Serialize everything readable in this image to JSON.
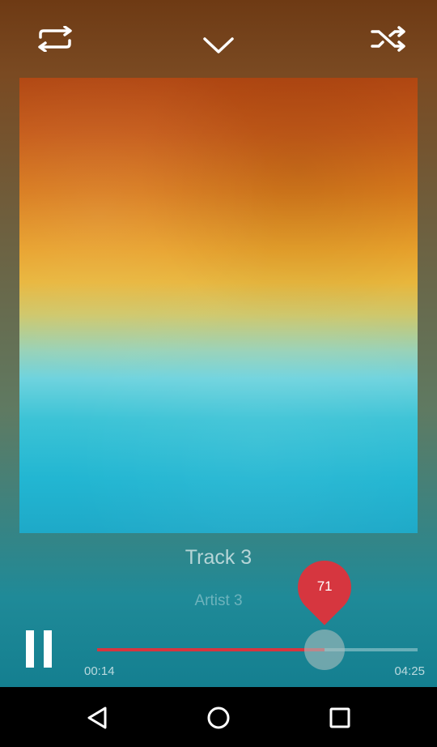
{
  "top": {
    "repeat_icon": "repeat-icon",
    "collapse_icon": "chevron-down-icon",
    "shuffle_icon": "shuffle-icon"
  },
  "track": {
    "title": "Track 3",
    "artist": "Artist 3"
  },
  "player": {
    "state": "playing",
    "progress_percent": 71,
    "progress_label": "71",
    "current_time": "00:14",
    "duration": "04:25",
    "accent_color": "#d6363f"
  },
  "navbar": {
    "back_icon": "back-triangle-icon",
    "home_icon": "home-circle-icon",
    "recents_icon": "recents-square-icon"
  }
}
